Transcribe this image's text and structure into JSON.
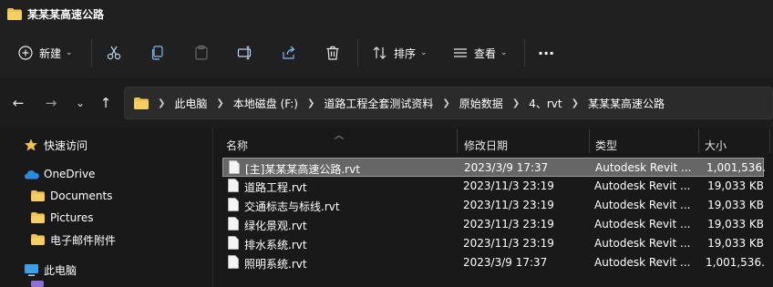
{
  "window": {
    "title": "某某某高速公路"
  },
  "toolbar": {
    "new_label": "新建",
    "sort_label": "排序",
    "view_label": "查看",
    "more_label": "···"
  },
  "address": {
    "crumbs": [
      "此电脑",
      "本地磁盘 (F:)",
      "道路工程全套测试资料",
      "原始数据",
      "4、rvt",
      "某某某高速公路"
    ]
  },
  "nav": {
    "quick_access": "快速访问",
    "onedrive": "OneDrive",
    "documents": "Documents",
    "pictures": "Pictures",
    "attachments": "电子邮件附件",
    "this_pc": "此电脑"
  },
  "columns": {
    "name": "名称",
    "date": "修改日期",
    "type": "类型",
    "size": "大小"
  },
  "files": [
    {
      "name": "[主]某某某高速公路.rvt",
      "date": "2023/3/9 17:37",
      "type": "Autodesk Revit ...",
      "size": "1,001,536..."
    },
    {
      "name": "道路工程.rvt",
      "date": "2023/11/3 23:19",
      "type": "Autodesk Revit ...",
      "size": "19,033 KB"
    },
    {
      "name": "交通标志与标线.rvt",
      "date": "2023/11/3 23:19",
      "type": "Autodesk Revit ...",
      "size": "19,033 KB"
    },
    {
      "name": "绿化景观.rvt",
      "date": "2023/11/3 23:19",
      "type": "Autodesk Revit ...",
      "size": "19,033 KB"
    },
    {
      "name": "排水系统.rvt",
      "date": "2023/11/3 23:19",
      "type": "Autodesk Revit ...",
      "size": "19,033 KB"
    },
    {
      "name": "照明系统.rvt",
      "date": "2023/3/9 17:37",
      "type": "Autodesk Revit ...",
      "size": "1,001,536..."
    }
  ],
  "colors": {
    "background": "#191919",
    "toolbar": "#202020",
    "selection": "#666666",
    "folder": "#f2c14e",
    "onedrive": "#2b8ae0"
  }
}
